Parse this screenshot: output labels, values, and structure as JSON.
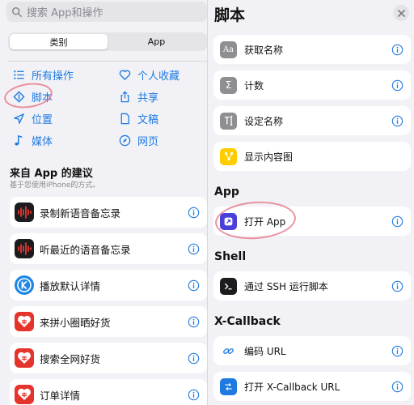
{
  "colors": {
    "accent": "#1f7ae0",
    "grey_bg": "#f2f2f6",
    "annotation": "#e66e82"
  },
  "search": {
    "placeholder": "搜索 App和操作"
  },
  "segments": [
    {
      "label": "类别",
      "selected": true
    },
    {
      "label": "App",
      "selected": false
    }
  ],
  "categories": [
    {
      "label": "所有操作",
      "icon": "list-icon"
    },
    {
      "label": "个人收藏",
      "icon": "heart-icon"
    },
    {
      "label": "脚本",
      "icon": "script-icon"
    },
    {
      "label": "共享",
      "icon": "share-icon"
    },
    {
      "label": "位置",
      "icon": "location-icon"
    },
    {
      "label": "文稿",
      "icon": "document-icon"
    },
    {
      "label": "媒体",
      "icon": "music-note-icon"
    },
    {
      "label": "网页",
      "icon": "compass-icon"
    }
  ],
  "suggestions": {
    "title": "来自 App 的建议",
    "subtitle": "基于您使用iPhone的方式。",
    "items": [
      {
        "label": "录制新语音备忘录",
        "icon": "voice-memo-icon"
      },
      {
        "label": "听最近的语音备忘录",
        "icon": "voice-memo-icon"
      },
      {
        "label": "播放默认详情",
        "icon": "k-app-icon"
      },
      {
        "label": "来拼小圈晒好货",
        "icon": "pinduoduo-icon"
      },
      {
        "label": "搜索全网好货",
        "icon": "pinduoduo-icon"
      },
      {
        "label": "订单详情",
        "icon": "pinduoduo-icon"
      }
    ]
  },
  "panel": {
    "title": "脚本",
    "scripting_items": [
      {
        "label": "获取名称",
        "icon": "aa-icon"
      },
      {
        "label": "计数",
        "icon": "sigma-icon"
      },
      {
        "label": "设定名称",
        "icon": "text-cursor-icon"
      },
      {
        "label": "显示内容图",
        "icon": "content-graph-icon"
      }
    ],
    "sections": [
      {
        "title": "App",
        "items": [
          {
            "label": "打开 App",
            "icon": "open-app-icon"
          }
        ]
      },
      {
        "title": "Shell",
        "items": [
          {
            "label": "通过 SSH 运行脚本",
            "icon": "terminal-icon"
          }
        ]
      },
      {
        "title": "X-Callback",
        "items": [
          {
            "label": "编码 URL",
            "icon": "link-icon"
          },
          {
            "label": "打开 X-Callback URL",
            "icon": "x-callback-icon"
          }
        ]
      }
    ]
  }
}
